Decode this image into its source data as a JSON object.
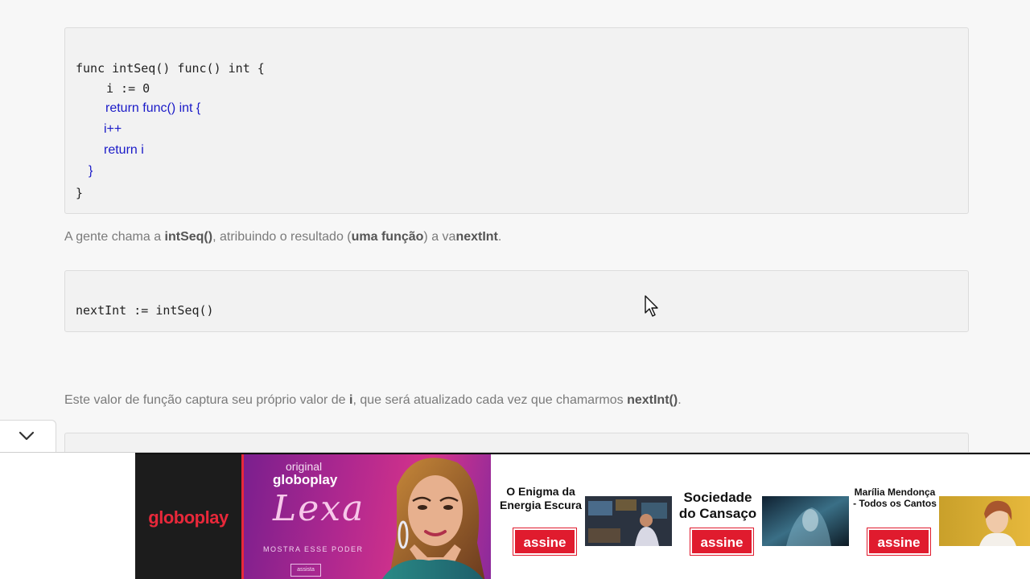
{
  "article": {
    "code_block_1": {
      "line1": "func intSeq() func() int {",
      "line2": "i := 0",
      "line3": "return func() int {",
      "line4": "i++",
      "line5": "return i",
      "line6": "}",
      "line7": "}"
    },
    "paragraph_1": {
      "t1": "A gente chama a ",
      "b1": "intSeq()",
      "t2": ", atribuindo o resultado (",
      "b2": "uma função",
      "t3": ") a va",
      "b3": "nextInt",
      "t4": "."
    },
    "code_block_2": {
      "line1": "nextInt := intSeq()"
    },
    "paragraph_2": {
      "t1": "Este valor de função captura seu próprio valor de ",
      "b1": "i",
      "t2": ", que será atualizado cada vez que chamarmos ",
      "b2": "nextInt()",
      "t3": "."
    }
  },
  "ad": {
    "brand_logo": "globoplay",
    "promo": {
      "small": "original",
      "brand": "globoplay",
      "title": "Lexa",
      "tagline": "MOSTRA ESSE PODER",
      "cta": "assista"
    },
    "shows": [
      {
        "title": "O Enigma da Energia Escura",
        "cta": "assine"
      },
      {
        "title": "Sociedade do Cansaço",
        "cta": "assine"
      },
      {
        "title": "Marília Mendonça - Todos os Cantos",
        "cta": "assine"
      }
    ]
  },
  "colors": {
    "code_keyword_blue": "#1a1ac8",
    "ad_red": "#e01b2e",
    "promo_purple": "#b0288f"
  },
  "icons": {
    "collapse": "chevron-down-icon",
    "pointer": "mouse-cursor-icon"
  }
}
